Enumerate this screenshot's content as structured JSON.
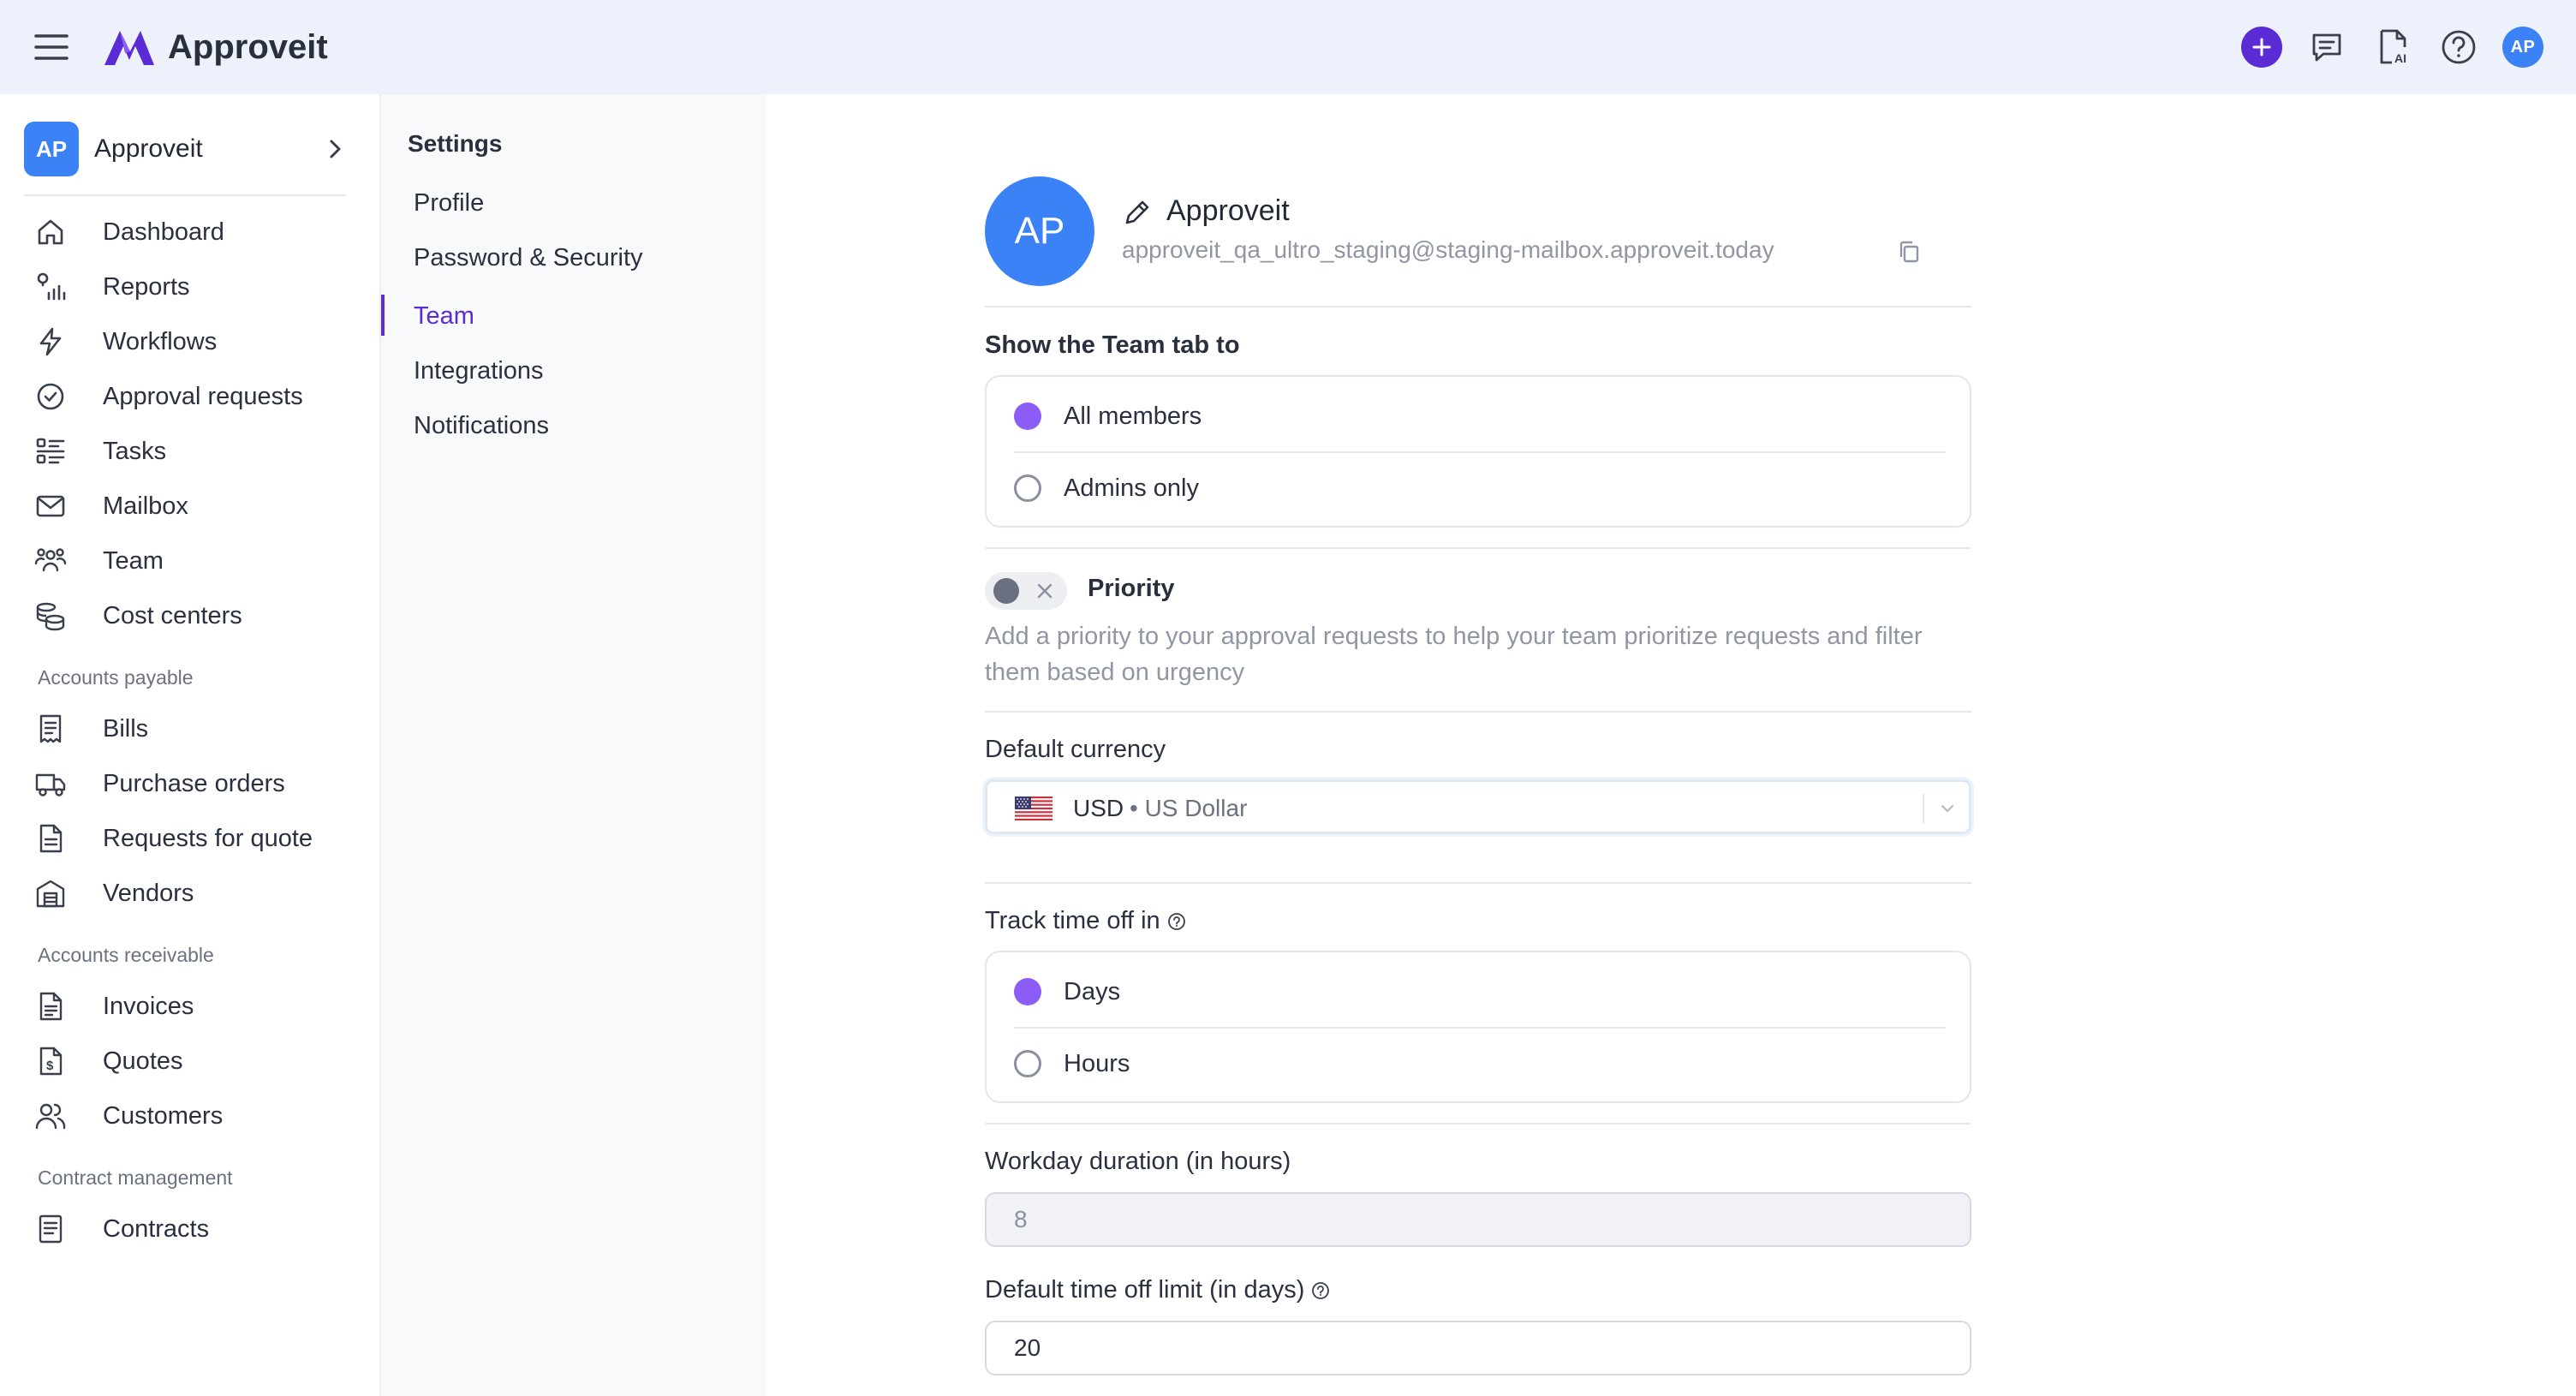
{
  "app": {
    "brand": "Approveit",
    "logo_icon": "approveit-logo",
    "accent_color": "#5b2bd6",
    "avatar_color": "#3b82f6"
  },
  "topbar": {
    "menu_icon": "hamburger-menu-icon",
    "actions": [
      {
        "icon": "plus-icon"
      },
      {
        "icon": "chat-icon"
      },
      {
        "icon": "ai-document-icon"
      },
      {
        "icon": "help-icon"
      }
    ],
    "avatar_initials": "AP"
  },
  "sidebar": {
    "org": {
      "initials": "AP",
      "name": "Approveit"
    },
    "items": [
      {
        "label": "Dashboard",
        "icon": "home-icon"
      },
      {
        "label": "Reports",
        "icon": "reports-icon"
      },
      {
        "label": "Workflows",
        "icon": "lightning-icon"
      },
      {
        "label": "Approval requests",
        "icon": "check-circle-icon"
      },
      {
        "label": "Tasks",
        "icon": "task-list-icon"
      },
      {
        "label": "Mailbox",
        "icon": "mail-icon"
      },
      {
        "label": "Team",
        "icon": "team-icon"
      },
      {
        "label": "Cost centers",
        "icon": "coins-icon"
      }
    ],
    "sections": [
      {
        "title": "Accounts payable",
        "items": [
          {
            "label": "Bills",
            "icon": "receipt-icon"
          },
          {
            "label": "Purchase orders",
            "icon": "truck-icon"
          },
          {
            "label": "Requests for quote",
            "icon": "document-icon"
          },
          {
            "label": "Vendors",
            "icon": "building-icon"
          }
        ]
      },
      {
        "title": "Accounts receivable",
        "items": [
          {
            "label": "Invoices",
            "icon": "invoice-icon"
          },
          {
            "label": "Quotes",
            "icon": "dollar-document-icon"
          },
          {
            "label": "Customers",
            "icon": "customers-icon"
          }
        ]
      },
      {
        "title": "Contract management",
        "items": [
          {
            "label": "Contracts",
            "icon": "contract-icon"
          }
        ]
      }
    ]
  },
  "settings_menu": {
    "title": "Settings",
    "items": [
      {
        "label": "Profile"
      },
      {
        "label": "Password & Security"
      },
      {
        "label": "Team",
        "active": true
      },
      {
        "label": "Integrations"
      },
      {
        "label": "Notifications"
      }
    ]
  },
  "profile": {
    "initials": "AP",
    "name": "Approveit",
    "email": "approveit_qa_ultro_staging@staging-mailbox.approveit.today"
  },
  "team_tab_visibility": {
    "label": "Show the Team tab to",
    "options": [
      {
        "label": "All members",
        "checked": true
      },
      {
        "label": "Admins only",
        "checked": false
      }
    ]
  },
  "priority": {
    "label": "Priority",
    "enabled": false,
    "description": "Add a priority to your approval requests to help your team prioritize requests and filter them based on urgency"
  },
  "currency": {
    "label": "Default currency",
    "code": "USD",
    "name": "• US Dollar",
    "flag_icon": "us-flag-icon"
  },
  "time_off": {
    "label": "Track time off in",
    "options": [
      {
        "label": "Days",
        "checked": true
      },
      {
        "label": "Hours",
        "checked": false
      }
    ]
  },
  "workday": {
    "label": "Workday duration (in hours)",
    "value": "8"
  },
  "time_off_limit": {
    "label": "Default time off limit (in days)",
    "value": "20"
  }
}
